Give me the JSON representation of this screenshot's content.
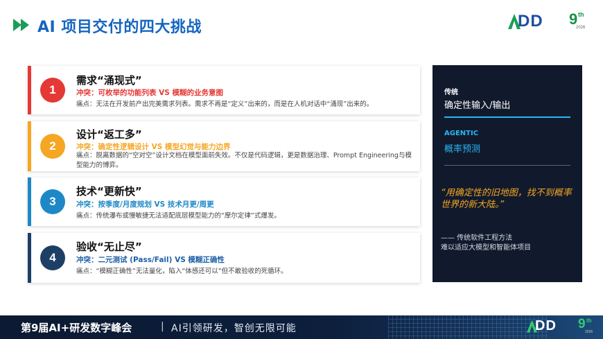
{
  "header": {
    "title": "AI 项目交付的四大挑战",
    "logo": {
      "text": "DD",
      "nine": "9",
      "sup": "th",
      "year": "2026"
    }
  },
  "cards": [
    {
      "number": "1",
      "title": "需求“涌现式”",
      "conflict": "冲突：可枚举的功能列表 VS 模糊的业务意图",
      "pain": "痛点：无法在开发前产出完美需求列表。需求不再是“定义”出来的，而是在人机对话中“涌现”出来的。",
      "color": "#e53935"
    },
    {
      "number": "2",
      "title": "设计“返工多”",
      "conflict": "冲突：确定性逻辑设计 VS 模型幻觉与能力边界",
      "pain": "痛点：脱离数据的“空对空”设计文档在模型面前失效。不仅是代码逻辑，更是数据治理、Prompt Engineering与模型能力的博弈。",
      "color": "#f5a623"
    },
    {
      "number": "3",
      "title": "技术“更新快”",
      "conflict": "冲突：按季度/月度规划 VS 技术月更/周更",
      "pain": "痛点：传统瀑布或慢敏捷无法适配底层模型能力的“摩尔定律”式爆发。",
      "color": "#1e88c7"
    },
    {
      "number": "4",
      "title": "验收“无止尽”",
      "conflict": "冲突：二元测试 (Pass/Fail) VS 模糊正确性",
      "pain": "痛点：“模糊正确性”无法量化，陷入“体感还可以”但不敢验收的死循环。",
      "color": "#1d3f66"
    }
  ],
  "panel": {
    "label1": "传统",
    "value1": "确定性输入/输出",
    "label2": "AGENTIC",
    "value2": "概率预测",
    "quote": "“用确定性的旧地图，找不到概率世界的新大陆。”",
    "footer1": "—— 传统软件工程方法",
    "footer2": "难以适应大模型和智能体项目",
    "accent": "#29b6f6",
    "quote_color": "#f5a623"
  },
  "footer": {
    "conference": "第9届AI+研发数字峰会",
    "separator": "|",
    "slogan": "AI引领研发，智创无限可能"
  }
}
